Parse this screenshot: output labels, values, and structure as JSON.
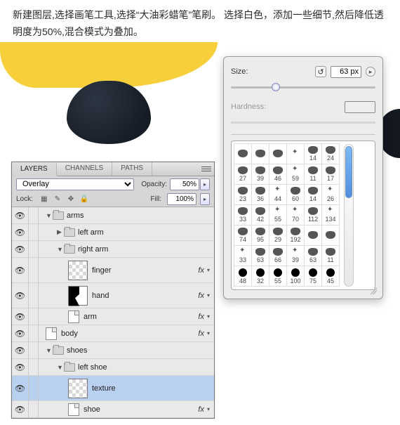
{
  "instructions": "新建图层,选择画笔工具,选择“大油彩蜡笔”笔刷。 选择白色，添加一些细节,然后降低透明度为50%,混合模式为叠加。",
  "layers_panel": {
    "tabs": [
      "LAYERS",
      "CHANNELS",
      "PATHS"
    ],
    "blend_mode": "Overlay",
    "opacity_label": "Opacity:",
    "opacity_value": "50%",
    "lock_label": "Lock:",
    "fill_label": "Fill:",
    "fill_value": "100%",
    "fx_label": "fx",
    "tree": [
      {
        "type": "folder",
        "name": "arms",
        "depth": 0,
        "open": true,
        "fx": false
      },
      {
        "type": "folder",
        "name": "left arm",
        "depth": 1,
        "open": false,
        "fx": false
      },
      {
        "type": "folder",
        "name": "right arm",
        "depth": 1,
        "open": true,
        "fx": false
      },
      {
        "type": "layer",
        "name": "finger",
        "depth": 2,
        "thumb": "checker",
        "fx": true
      },
      {
        "type": "layer",
        "name": "hand",
        "depth": 2,
        "thumb": "hand",
        "fx": true
      },
      {
        "type": "doc",
        "name": "arm",
        "depth": 2,
        "fx": true
      },
      {
        "type": "doc",
        "name": "body",
        "depth": 0,
        "fx": true
      },
      {
        "type": "folder",
        "name": "shoes",
        "depth": 0,
        "open": true,
        "fx": false
      },
      {
        "type": "folder",
        "name": "left shoe",
        "depth": 1,
        "open": true,
        "fx": false
      },
      {
        "type": "layer",
        "name": "texture",
        "depth": 2,
        "thumb": "checker",
        "fx": false,
        "selected": true
      },
      {
        "type": "doc",
        "name": "shoe",
        "depth": 2,
        "fx": true
      }
    ]
  },
  "brush_panel": {
    "size_label": "Size:",
    "size_value": "63 px",
    "hardness_label": "Hardness:",
    "tips": [
      [
        " ",
        " ",
        " ",
        " ",
        "14",
        "24"
      ],
      [
        "27",
        "39",
        "46",
        "59",
        "11",
        "17"
      ],
      [
        "23",
        "36",
        "44",
        "60",
        "14",
        "26"
      ],
      [
        "33",
        "42",
        "55",
        "70",
        "112",
        "134"
      ],
      [
        "74",
        "95",
        "29",
        "192",
        " ",
        " "
      ],
      [
        "33",
        "63",
        "66",
        "39",
        "63",
        "11"
      ],
      [
        "48",
        "32",
        "55",
        "100",
        "75",
        "45"
      ]
    ],
    "dot_rows": [
      6
    ]
  }
}
